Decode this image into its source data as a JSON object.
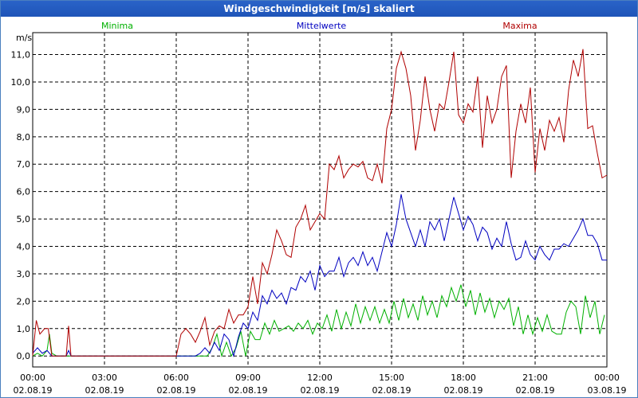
{
  "window": {
    "title": "Windgeschwindigkeit [m/s] skaliert"
  },
  "colors": {
    "minima": "#00b000",
    "mittelwerte": "#0000c0",
    "maxima": "#b00000",
    "titlebar": "#1e54b8"
  },
  "chart_data": {
    "type": "line",
    "title": "Windgeschwindigkeit [m/s] skaliert",
    "ylabel": "m/s",
    "xlabel": "",
    "ylim": [
      -0.4,
      11.8
    ],
    "xlim": [
      0,
      24
    ],
    "grid": true,
    "legend_position": "top",
    "y_ticks": [
      "0,0",
      "1,0",
      "2,0",
      "3,0",
      "4,0",
      "5,0",
      "6,0",
      "7,0",
      "8,0",
      "9,0",
      "10,0",
      "11,0"
    ],
    "x_ticks": [
      {
        "time": "00:00",
        "date": "02.08.19"
      },
      {
        "time": "03:00",
        "date": "02.08.19"
      },
      {
        "time": "06:00",
        "date": "02.08.19"
      },
      {
        "time": "09:00",
        "date": "02.08.19"
      },
      {
        "time": "12:00",
        "date": "02.08.19"
      },
      {
        "time": "15:00",
        "date": "02.08.19"
      },
      {
        "time": "18:00",
        "date": "02.08.19"
      },
      {
        "time": "21:00",
        "date": "02.08.19"
      },
      {
        "time": "00:00",
        "date": "03.08.19"
      }
    ],
    "series": [
      {
        "name": "Minima",
        "color": "#00b000",
        "points": [
          [
            0.0,
            0.0
          ],
          [
            0.2,
            0.1
          ],
          [
            0.4,
            0.0
          ],
          [
            0.6,
            0.2
          ],
          [
            0.7,
            0.8
          ],
          [
            0.8,
            0.1
          ],
          [
            1.0,
            0.0
          ],
          [
            1.5,
            0.0
          ],
          [
            6.0,
            0.0
          ],
          [
            7.3,
            0.0
          ],
          [
            7.5,
            0.3
          ],
          [
            7.7,
            0.8
          ],
          [
            7.9,
            0.0
          ],
          [
            8.1,
            0.5
          ],
          [
            8.3,
            0.0
          ],
          [
            8.5,
            0.3
          ],
          [
            8.7,
            0.9
          ],
          [
            8.9,
            0.0
          ],
          [
            9.1,
            0.9
          ],
          [
            9.3,
            0.6
          ],
          [
            9.5,
            0.6
          ],
          [
            9.7,
            1.2
          ],
          [
            9.9,
            0.8
          ],
          [
            10.1,
            1.3
          ],
          [
            10.3,
            0.9
          ],
          [
            10.5,
            1.0
          ],
          [
            10.7,
            1.1
          ],
          [
            10.9,
            0.9
          ],
          [
            11.1,
            1.2
          ],
          [
            11.3,
            1.0
          ],
          [
            11.5,
            1.3
          ],
          [
            11.7,
            0.8
          ],
          [
            11.9,
            1.2
          ],
          [
            12.1,
            1.0
          ],
          [
            12.3,
            1.5
          ],
          [
            12.5,
            0.9
          ],
          [
            12.7,
            1.7
          ],
          [
            12.9,
            1.0
          ],
          [
            13.1,
            1.6
          ],
          [
            13.3,
            1.1
          ],
          [
            13.5,
            1.9
          ],
          [
            13.7,
            1.2
          ],
          [
            13.9,
            1.8
          ],
          [
            14.1,
            1.3
          ],
          [
            14.3,
            1.8
          ],
          [
            14.5,
            1.2
          ],
          [
            14.7,
            1.7
          ],
          [
            14.9,
            1.2
          ],
          [
            15.1,
            2.0
          ],
          [
            15.3,
            1.3
          ],
          [
            15.5,
            2.1
          ],
          [
            15.7,
            1.4
          ],
          [
            15.9,
            1.9
          ],
          [
            16.1,
            1.3
          ],
          [
            16.3,
            2.2
          ],
          [
            16.5,
            1.5
          ],
          [
            16.7,
            2.0
          ],
          [
            16.9,
            1.4
          ],
          [
            17.1,
            2.2
          ],
          [
            17.3,
            1.8
          ],
          [
            17.5,
            2.5
          ],
          [
            17.7,
            2.0
          ],
          [
            17.9,
            2.6
          ],
          [
            18.1,
            1.8
          ],
          [
            18.3,
            2.4
          ],
          [
            18.5,
            1.5
          ],
          [
            18.7,
            2.3
          ],
          [
            18.9,
            1.6
          ],
          [
            19.1,
            2.1
          ],
          [
            19.3,
            1.4
          ],
          [
            19.5,
            2.0
          ],
          [
            19.7,
            1.7
          ],
          [
            19.9,
            2.1
          ],
          [
            20.1,
            1.1
          ],
          [
            20.3,
            1.8
          ],
          [
            20.5,
            0.8
          ],
          [
            20.7,
            1.5
          ],
          [
            20.9,
            0.8
          ],
          [
            21.1,
            1.4
          ],
          [
            21.3,
            0.9
          ],
          [
            21.5,
            1.5
          ],
          [
            21.7,
            0.9
          ],
          [
            21.9,
            0.8
          ],
          [
            22.1,
            0.8
          ],
          [
            22.3,
            1.6
          ],
          [
            22.5,
            2.0
          ],
          [
            22.7,
            1.8
          ],
          [
            22.9,
            0.8
          ],
          [
            23.1,
            2.2
          ],
          [
            23.3,
            1.4
          ],
          [
            23.5,
            2.0
          ],
          [
            23.7,
            0.8
          ],
          [
            23.9,
            1.5
          ]
        ]
      },
      {
        "name": "Mittelwerte",
        "color": "#0000c0",
        "points": [
          [
            0.0,
            0.1
          ],
          [
            0.2,
            0.3
          ],
          [
            0.4,
            0.1
          ],
          [
            0.6,
            0.2
          ],
          [
            0.8,
            0.0
          ],
          [
            1.0,
            0.0
          ],
          [
            1.4,
            0.0
          ],
          [
            1.5,
            0.2
          ],
          [
            1.6,
            0.0
          ],
          [
            6.0,
            0.0
          ],
          [
            6.8,
            0.0
          ],
          [
            7.0,
            0.1
          ],
          [
            7.2,
            0.3
          ],
          [
            7.4,
            0.1
          ],
          [
            7.6,
            0.5
          ],
          [
            7.8,
            0.2
          ],
          [
            8.0,
            0.8
          ],
          [
            8.2,
            0.6
          ],
          [
            8.4,
            0.0
          ],
          [
            8.6,
            0.7
          ],
          [
            8.8,
            1.2
          ],
          [
            9.0,
            1.0
          ],
          [
            9.2,
            1.6
          ],
          [
            9.4,
            1.3
          ],
          [
            9.6,
            2.2
          ],
          [
            9.8,
            1.9
          ],
          [
            10.0,
            2.4
          ],
          [
            10.2,
            2.1
          ],
          [
            10.4,
            2.3
          ],
          [
            10.6,
            1.9
          ],
          [
            10.8,
            2.5
          ],
          [
            11.0,
            2.4
          ],
          [
            11.2,
            2.9
          ],
          [
            11.4,
            2.7
          ],
          [
            11.6,
            3.1
          ],
          [
            11.8,
            2.4
          ],
          [
            12.0,
            3.3
          ],
          [
            12.2,
            2.9
          ],
          [
            12.4,
            3.1
          ],
          [
            12.6,
            3.1
          ],
          [
            12.8,
            3.6
          ],
          [
            13.0,
            2.9
          ],
          [
            13.2,
            3.4
          ],
          [
            13.4,
            3.6
          ],
          [
            13.6,
            3.3
          ],
          [
            13.8,
            3.8
          ],
          [
            14.0,
            3.3
          ],
          [
            14.2,
            3.6
          ],
          [
            14.4,
            3.1
          ],
          [
            14.6,
            3.8
          ],
          [
            14.8,
            4.5
          ],
          [
            15.0,
            4.0
          ],
          [
            15.2,
            4.8
          ],
          [
            15.4,
            5.9
          ],
          [
            15.6,
            5.0
          ],
          [
            15.8,
            4.5
          ],
          [
            16.0,
            4.0
          ],
          [
            16.2,
            4.6
          ],
          [
            16.4,
            4.0
          ],
          [
            16.6,
            4.9
          ],
          [
            16.8,
            4.6
          ],
          [
            17.0,
            5.0
          ],
          [
            17.2,
            4.2
          ],
          [
            17.4,
            5.0
          ],
          [
            17.6,
            5.8
          ],
          [
            17.8,
            5.2
          ],
          [
            18.0,
            4.6
          ],
          [
            18.2,
            5.1
          ],
          [
            18.4,
            4.8
          ],
          [
            18.6,
            4.2
          ],
          [
            18.8,
            4.7
          ],
          [
            19.0,
            4.5
          ],
          [
            19.2,
            3.9
          ],
          [
            19.4,
            4.3
          ],
          [
            19.6,
            4.0
          ],
          [
            19.8,
            4.9
          ],
          [
            20.0,
            4.1
          ],
          [
            20.2,
            3.5
          ],
          [
            20.4,
            3.6
          ],
          [
            20.6,
            4.2
          ],
          [
            20.8,
            3.7
          ],
          [
            21.0,
            3.5
          ],
          [
            21.2,
            4.0
          ],
          [
            21.4,
            3.7
          ],
          [
            21.6,
            3.5
          ],
          [
            21.8,
            3.9
          ],
          [
            22.0,
            3.9
          ],
          [
            22.2,
            4.1
          ],
          [
            22.4,
            4.0
          ],
          [
            22.6,
            4.3
          ],
          [
            22.8,
            4.6
          ],
          [
            23.0,
            5.0
          ],
          [
            23.2,
            4.4
          ],
          [
            23.4,
            4.4
          ],
          [
            23.6,
            4.1
          ],
          [
            23.8,
            3.5
          ],
          [
            24.0,
            3.5
          ]
        ]
      },
      {
        "name": "Maxima",
        "color": "#b00000",
        "points": [
          [
            0.0,
            0.0
          ],
          [
            0.15,
            1.3
          ],
          [
            0.3,
            0.8
          ],
          [
            0.5,
            1.0
          ],
          [
            0.65,
            1.0
          ],
          [
            0.8,
            0.0
          ],
          [
            1.0,
            0.0
          ],
          [
            1.4,
            0.0
          ],
          [
            1.5,
            1.1
          ],
          [
            1.6,
            0.0
          ],
          [
            6.0,
            0.0
          ],
          [
            6.2,
            0.8
          ],
          [
            6.4,
            1.0
          ],
          [
            6.6,
            0.8
          ],
          [
            6.8,
            0.5
          ],
          [
            7.0,
            0.9
          ],
          [
            7.2,
            1.4
          ],
          [
            7.4,
            0.4
          ],
          [
            7.6,
            0.9
          ],
          [
            7.8,
            1.1
          ],
          [
            8.0,
            1.0
          ],
          [
            8.2,
            1.7
          ],
          [
            8.4,
            1.2
          ],
          [
            8.6,
            1.5
          ],
          [
            8.8,
            1.5
          ],
          [
            9.0,
            1.8
          ],
          [
            9.2,
            2.9
          ],
          [
            9.4,
            1.9
          ],
          [
            9.6,
            3.4
          ],
          [
            9.8,
            3.0
          ],
          [
            10.0,
            3.7
          ],
          [
            10.2,
            4.6
          ],
          [
            10.4,
            4.2
          ],
          [
            10.6,
            3.7
          ],
          [
            10.8,
            3.6
          ],
          [
            11.0,
            4.7
          ],
          [
            11.2,
            5.0
          ],
          [
            11.4,
            5.5
          ],
          [
            11.6,
            4.6
          ],
          [
            11.8,
            4.9
          ],
          [
            12.0,
            5.2
          ],
          [
            12.2,
            5.0
          ],
          [
            12.4,
            7.0
          ],
          [
            12.6,
            6.8
          ],
          [
            12.8,
            7.3
          ],
          [
            13.0,
            6.5
          ],
          [
            13.2,
            6.8
          ],
          [
            13.4,
            7.0
          ],
          [
            13.6,
            6.9
          ],
          [
            13.8,
            7.1
          ],
          [
            14.0,
            6.5
          ],
          [
            14.2,
            6.4
          ],
          [
            14.4,
            7.0
          ],
          [
            14.6,
            6.3
          ],
          [
            14.8,
            8.3
          ],
          [
            15.0,
            9.0
          ],
          [
            15.2,
            10.5
          ],
          [
            15.4,
            11.1
          ],
          [
            15.6,
            10.5
          ],
          [
            15.8,
            9.5
          ],
          [
            16.0,
            7.5
          ],
          [
            16.2,
            8.6
          ],
          [
            16.4,
            10.2
          ],
          [
            16.6,
            9.0
          ],
          [
            16.8,
            8.2
          ],
          [
            17.0,
            9.2
          ],
          [
            17.2,
            9.0
          ],
          [
            17.4,
            10.0
          ],
          [
            17.6,
            11.1
          ],
          [
            17.8,
            8.8
          ],
          [
            18.0,
            8.5
          ],
          [
            18.2,
            9.2
          ],
          [
            18.4,
            8.9
          ],
          [
            18.6,
            10.2
          ],
          [
            18.8,
            7.6
          ],
          [
            19.0,
            9.5
          ],
          [
            19.2,
            8.5
          ],
          [
            19.4,
            9.0
          ],
          [
            19.6,
            10.2
          ],
          [
            19.8,
            10.6
          ],
          [
            20.0,
            6.5
          ],
          [
            20.2,
            8.2
          ],
          [
            20.4,
            9.2
          ],
          [
            20.6,
            8.5
          ],
          [
            20.8,
            9.8
          ],
          [
            21.0,
            6.7
          ],
          [
            21.2,
            8.3
          ],
          [
            21.4,
            7.5
          ],
          [
            21.6,
            8.6
          ],
          [
            21.8,
            8.2
          ],
          [
            22.0,
            8.7
          ],
          [
            22.2,
            7.8
          ],
          [
            22.4,
            9.7
          ],
          [
            22.6,
            10.8
          ],
          [
            22.8,
            10.2
          ],
          [
            23.0,
            11.2
          ],
          [
            23.2,
            8.3
          ],
          [
            23.4,
            8.4
          ],
          [
            23.6,
            7.4
          ],
          [
            23.8,
            6.5
          ],
          [
            24.0,
            6.6
          ]
        ]
      }
    ]
  }
}
